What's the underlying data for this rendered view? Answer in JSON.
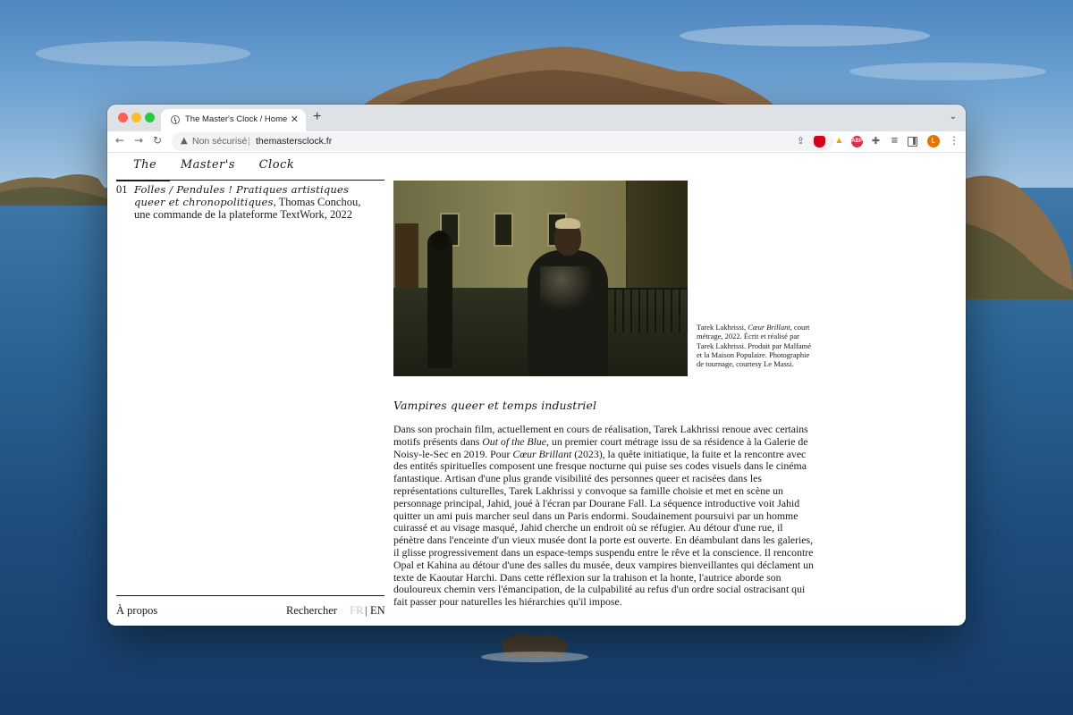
{
  "browser": {
    "tab": {
      "title": "The Master's Clock / Home",
      "close": "✕"
    },
    "new_tab": "+",
    "tab_search": "⌄",
    "nav": {
      "back": "←",
      "forward": "→",
      "reload": "↻"
    },
    "omnibox": {
      "warning_icon": "▲",
      "security_label": "Non sécurisé",
      "separator": "|",
      "url": "themastersclock.fr",
      "share_icon": "⇪",
      "bookmark_icon": "☆"
    },
    "extensions": {
      "abp_label": "ABP",
      "warning_icon": "▲",
      "puzzle_icon": "✚",
      "playlist_icon": "≡",
      "avatar_letter": "L",
      "menu_icon": "⋮"
    }
  },
  "page": {
    "site_title": "The Master's Clock",
    "entries": [
      {
        "number": "01",
        "title": "Folles / Pendules ! Pratiques artistiques queer et chronopolitiques",
        "description": ", Thomas Conchou, une commande de la plateforme TextWork, 2022"
      }
    ],
    "footer": {
      "about": "À propos",
      "search": "Rechercher",
      "lang_fr": "FR",
      "lang_separator": "|",
      "lang_en": "EN"
    },
    "image_caption": {
      "author": "Tarek Lakhrissi, ",
      "work": "Cœur Brillant",
      "rest": ", court métrage, 2022. Écrit et réalisé par Tarek Lakhrissi. Produit par Malfamé et la Maison Populaire. Photographie de tournage, courtesy Le Massi."
    },
    "article": {
      "heading": "Vampires queer et temps industriel",
      "p1": "Dans son prochain film, actuellement en cours de réalisation, Tarek Lakhrissi renoue avec certains motifs présents dans ",
      "title_1": "Out of the Blue",
      "p2": ", un premier court métrage issu de sa résidence à la Galerie de Noisy-le-Sec en 2019. Pour ",
      "title_2": "Cœur Brillant",
      "p3": " (2023), la quête initiatique, la fuite et la rencontre avec des entités spirituelles composent une fresque nocturne qui puise ses codes visuels dans le cinéma fantastique. Artisan d'une plus grande visibilité des personnes queer et racisées dans les représentations culturelles, Tarek Lakhrissi y convoque sa famille choisie et met en scène un personnage principal, Jahid, joué à l'écran par Dourane Fall. La séquence introductive voit Jahid quitter un ami puis marcher seul dans un Paris endormi. Soudainement poursuivi par un homme cuirassé et au visage masqué, Jahid cherche un endroit où se réfugier. Au détour d'une rue, il pénètre dans l'enceinte d'un vieux musée dont la porte est ouverte. En déambulant dans les galeries, il glisse progressivement dans un espace-temps suspendu entre le rêve et la conscience. Il rencontre Opal et Kahina au détour d'une des salles du musée, deux vampires bienveillantes qui déclament un texte de Kaoutar Harchi. Dans cette réflexion sur la trahison et la honte, l'autrice aborde son douloureux chemin vers l'émancipation, de la culpabilité au refus d'un ordre social ostracisant qui fait passer pour naturelles les hiérarchies qu'il impose."
    }
  },
  "colors": {
    "tabstrip": "#dee1e6",
    "omnibox": "#f1f3f4",
    "inactive_lang": "#c8c8c8",
    "text": "#1a1a1a",
    "avatar": "#e37400"
  }
}
